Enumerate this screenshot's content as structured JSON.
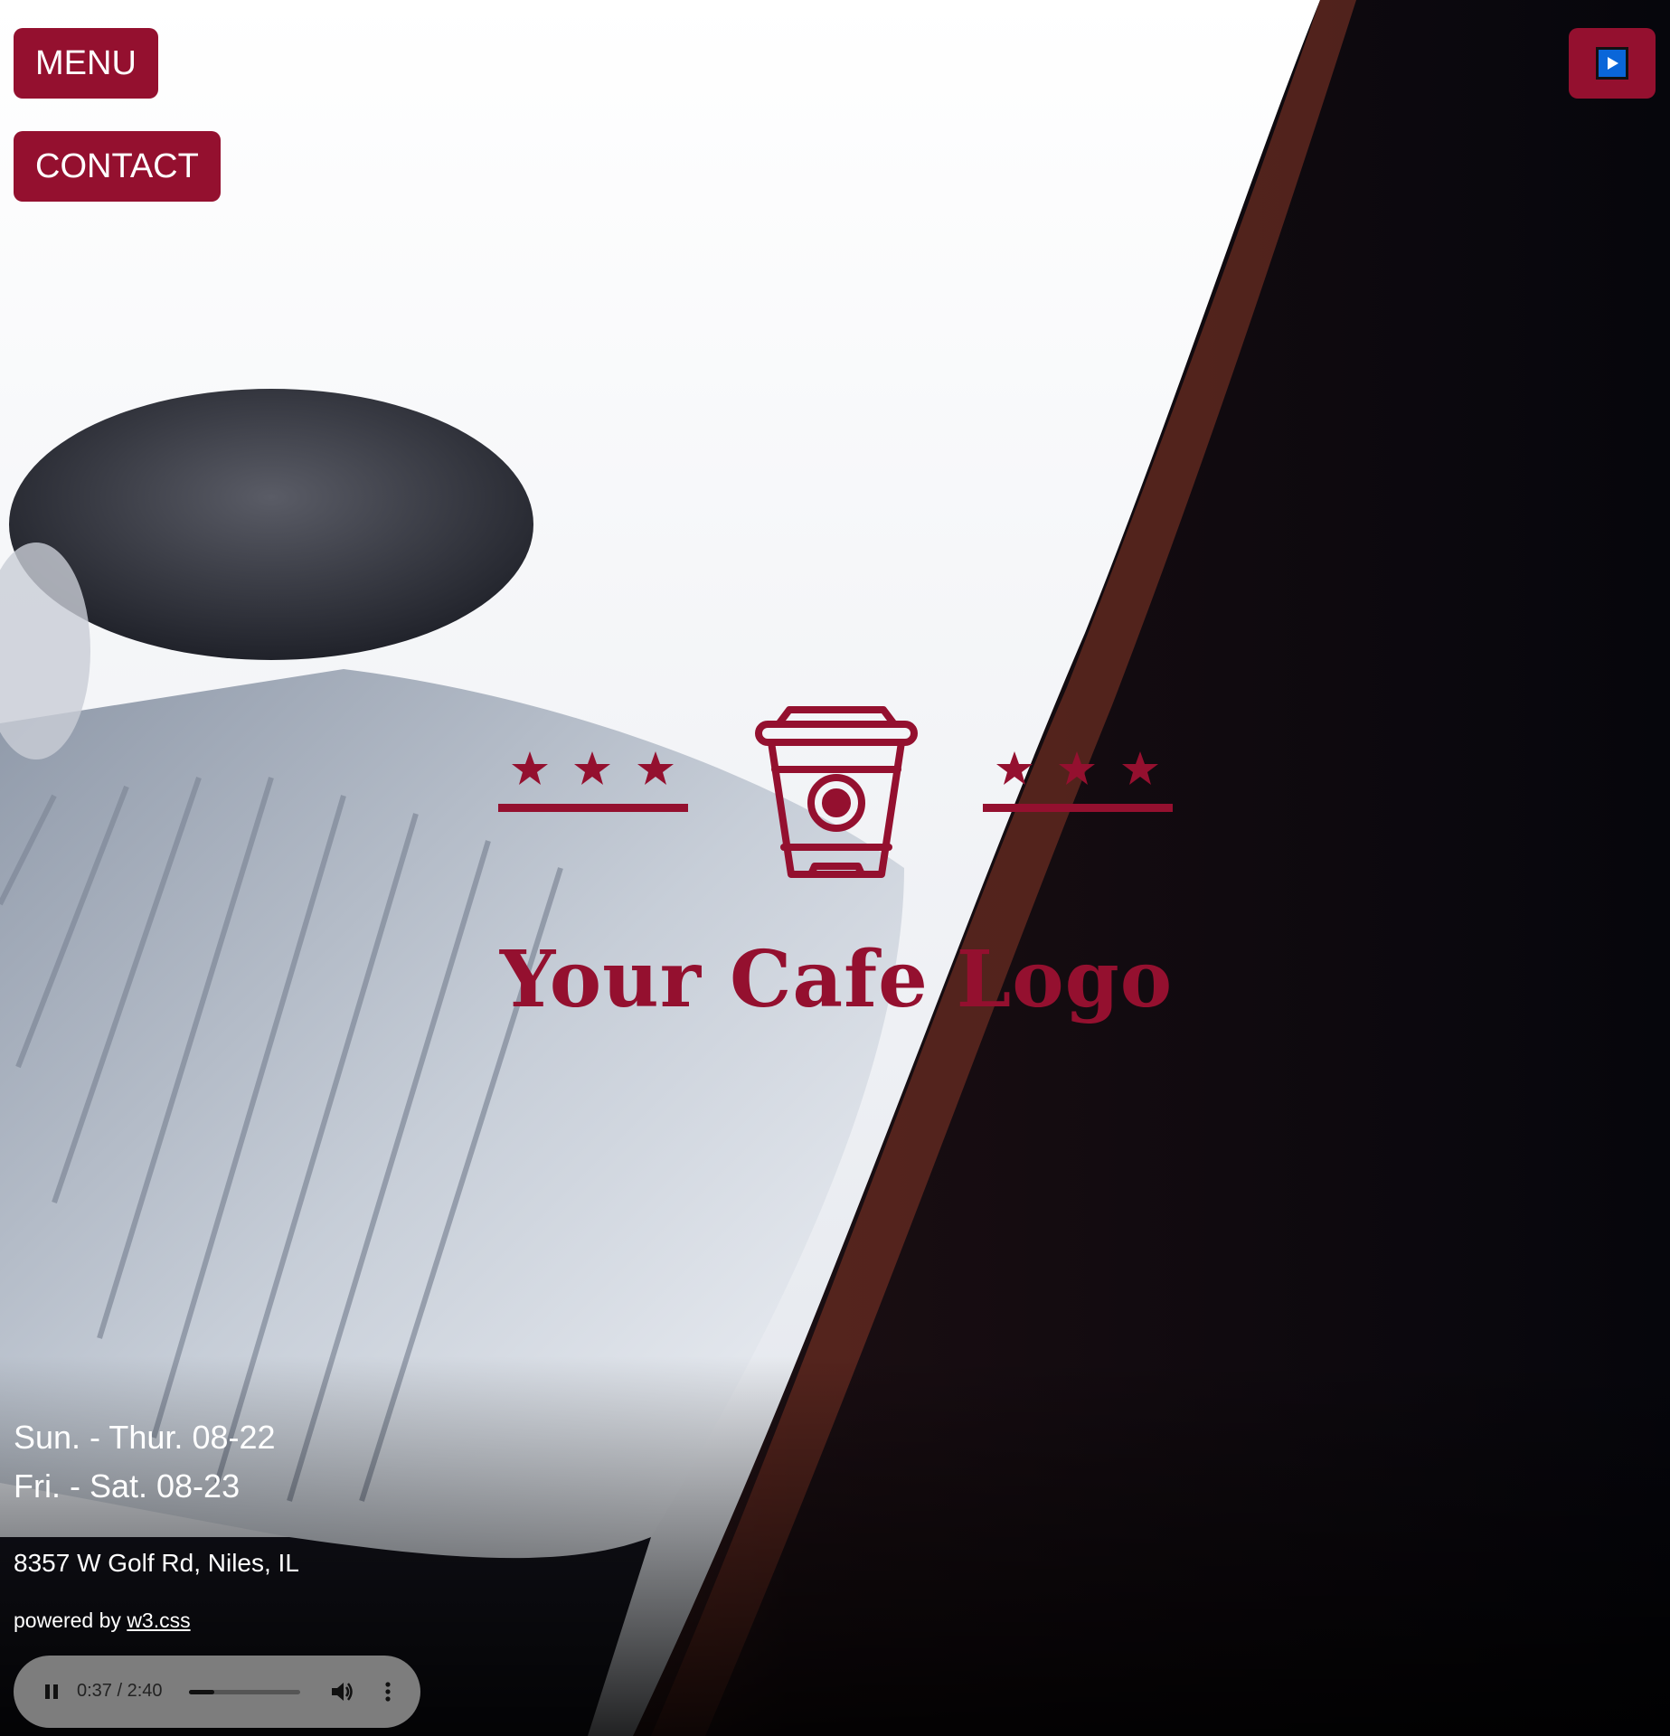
{
  "nav": {
    "menu_label": "MENU",
    "contact_label": "CONTACT",
    "play_icon": "play-icon"
  },
  "logo": {
    "text": "Your Cafe Logo",
    "icon": "coffee-cup-icon",
    "decoration": "three-stars-with-underline"
  },
  "info": {
    "hours_weekday": "Sun. - Thur. 08-22",
    "hours_weekend": "Fri. - Sat. 08-23",
    "address": "8357 W Golf Rd, Niles, IL",
    "powered_prefix": "powered by ",
    "powered_link": "w3.css"
  },
  "audio": {
    "time": "0:37 / 2:40",
    "progress": 0.23,
    "state": "playing"
  },
  "colors": {
    "brand": "#94102f",
    "play_icon_fill": "#0a66d9",
    "text": "#ffffff",
    "audio_bg": "#7d7d7d"
  }
}
